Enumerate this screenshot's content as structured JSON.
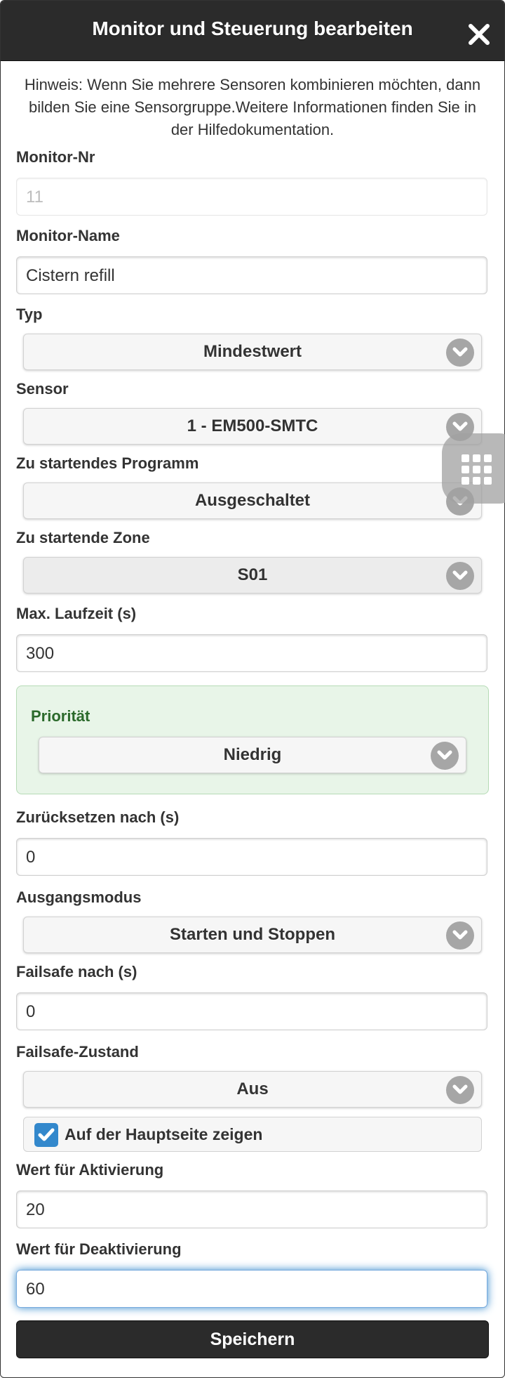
{
  "header": {
    "title": "Monitor und Steuerung bearbeiten",
    "close_icon": "close-icon"
  },
  "hint": "Hinweis: Wenn Sie mehrere Sensoren kombinieren möchten, dann bilden Sie eine Sensorgruppe.Weitere Informationen finden Sie in der Hilfedokumentation.",
  "fields": {
    "monitor_nr": {
      "label": "Monitor-Nr",
      "value": "11"
    },
    "monitor_name": {
      "label": "Monitor-Name",
      "value": "Cistern refill"
    },
    "typ": {
      "label": "Typ",
      "value": "Mindestwert"
    },
    "sensor": {
      "label": "Sensor",
      "value": "1 - EM500-SMTC"
    },
    "programm": {
      "label": "Zu startendes Programm",
      "value": "Ausgeschaltet"
    },
    "zone": {
      "label": "Zu startende Zone",
      "value": "S01"
    },
    "max_laufzeit": {
      "label": "Max. Laufzeit (s)",
      "value": "300"
    },
    "prioritaet": {
      "label": "Priorität",
      "value": "Niedrig"
    },
    "zuruecksetzen": {
      "label": "Zurücksetzen nach (s)",
      "value": "0"
    },
    "ausgangsmodus": {
      "label": "Ausgangsmodus",
      "value": "Starten und Stoppen"
    },
    "failsafe_nach": {
      "label": "Failsafe nach (s)",
      "value": "0"
    },
    "failsafe_zustand": {
      "label": "Failsafe-Zustand",
      "value": "Aus"
    },
    "hauptseite": {
      "label": "Auf der Hauptseite zeigen",
      "checked": true
    },
    "wert_aktivierung": {
      "label": "Wert für Aktivierung",
      "value": "20"
    },
    "wert_deaktivierung": {
      "label": "Wert für Deaktivierung",
      "value": "60"
    }
  },
  "save_label": "Speichern",
  "colors": {
    "header_bg": "#2b2b2b",
    "accent": "#3388cc",
    "priority_bg": "#e8f5e8",
    "priority_label": "#2b6a2b"
  },
  "floating_button_icon": "grid-icon"
}
